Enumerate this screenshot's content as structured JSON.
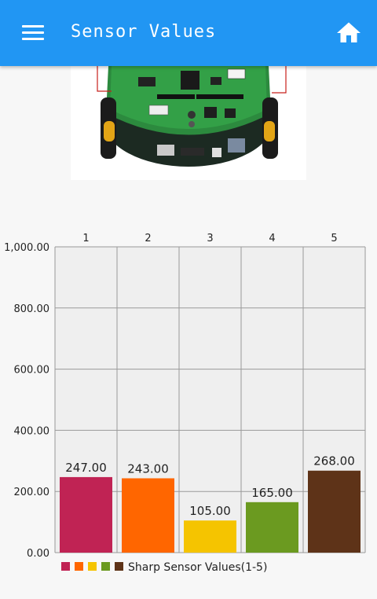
{
  "appbar": {
    "title": "Sensor Values",
    "menu_icon": "hamburger-menu-icon",
    "home_icon": "home-icon",
    "color": "#2196f3"
  },
  "image": {
    "name": "robot-board-image"
  },
  "chart_data": {
    "type": "bar",
    "categories": [
      "1",
      "2",
      "3",
      "4",
      "5"
    ],
    "values": [
      247.0,
      243.0,
      105.0,
      165.0,
      268.0
    ],
    "value_labels": [
      "247.00",
      "243.00",
      "105.00",
      "165.00",
      "268.00"
    ],
    "colors": [
      "#c02354",
      "#ff6600",
      "#f5c400",
      "#6b9a20",
      "#5e3318"
    ],
    "y_ticks": [
      "0.00",
      "200.00",
      "400.00",
      "600.00",
      "800.00",
      "1,000.00"
    ],
    "y_tick_values": [
      0,
      200,
      400,
      600,
      800,
      1000
    ],
    "ylim": [
      0,
      1000
    ],
    "legend": "Sharp Sensor Values(1-5)",
    "grid": true,
    "category_axis_position": "top",
    "legend_position": "bottom-left"
  }
}
